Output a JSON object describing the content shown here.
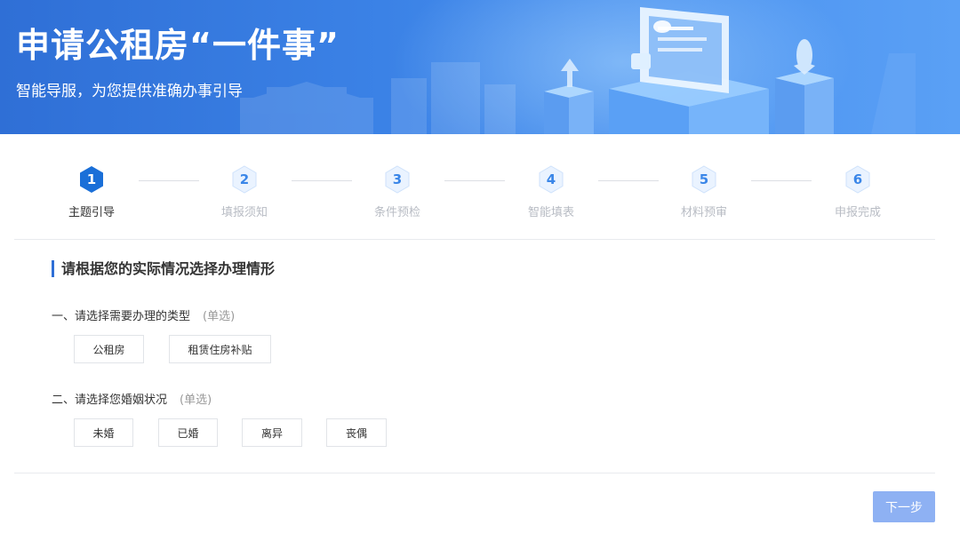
{
  "banner": {
    "title": "申请公租房“一件事”",
    "subtitle": "智能导服，为您提供准确办事引导"
  },
  "steps": [
    {
      "num": "1",
      "label": "主题引导",
      "active": true
    },
    {
      "num": "2",
      "label": "填报须知",
      "active": false
    },
    {
      "num": "3",
      "label": "条件预检",
      "active": false
    },
    {
      "num": "4",
      "label": "智能填表",
      "active": false
    },
    {
      "num": "5",
      "label": "材料预审",
      "active": false
    },
    {
      "num": "6",
      "label": "申报完成",
      "active": false
    }
  ],
  "form": {
    "section_title": "请根据您的实际情况选择办理情形",
    "questions": [
      {
        "label": "一、请选择需要办理的类型",
        "hint": "(单选)",
        "options": [
          "公租房",
          "租赁住房补贴"
        ]
      },
      {
        "label": "二、请选择您婚姻状况",
        "hint": "(单选)",
        "options": [
          "未婚",
          "已婚",
          "离异",
          "丧偶"
        ]
      }
    ]
  },
  "footer": {
    "next_label": "下一步"
  },
  "colors": {
    "primary": "#2f6fd6",
    "step_active": "#1a6fd8",
    "button_disabled": "#8eb1f3"
  }
}
